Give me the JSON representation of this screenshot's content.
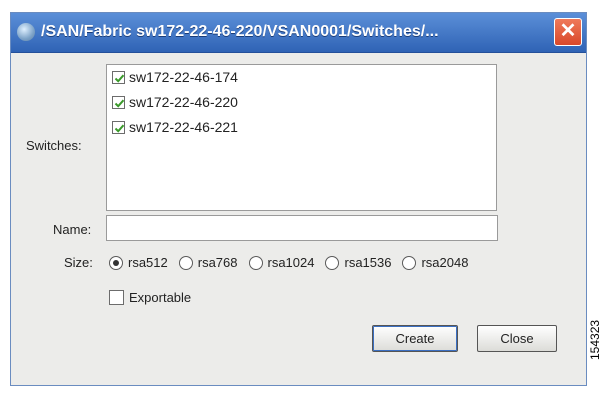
{
  "window": {
    "title": "/SAN/Fabric sw172-22-46-220/VSAN0001/Switches/...",
    "close_glyph": "✕"
  },
  "form": {
    "switches_label": "Switches:",
    "switches": [
      {
        "label": "sw172-22-46-174",
        "checked": true
      },
      {
        "label": "sw172-22-46-220",
        "checked": true
      },
      {
        "label": "sw172-22-46-221",
        "checked": true
      }
    ],
    "name_label": "Name:",
    "name_value": "",
    "size_label": "Size:",
    "size_options": [
      {
        "label": "rsa512",
        "selected": true
      },
      {
        "label": "rsa768",
        "selected": false
      },
      {
        "label": "rsa1024",
        "selected": false
      },
      {
        "label": "rsa1536",
        "selected": false
      },
      {
        "label": "rsa2048",
        "selected": false
      }
    ],
    "exportable_label": "Exportable",
    "exportable_checked": false
  },
  "buttons": {
    "create": "Create",
    "close": "Close"
  },
  "figure_id": "154323",
  "colors": {
    "titlebar": "#2f63b5",
    "checkmark": "#3a9a2a",
    "close_button": "#d9482a"
  }
}
